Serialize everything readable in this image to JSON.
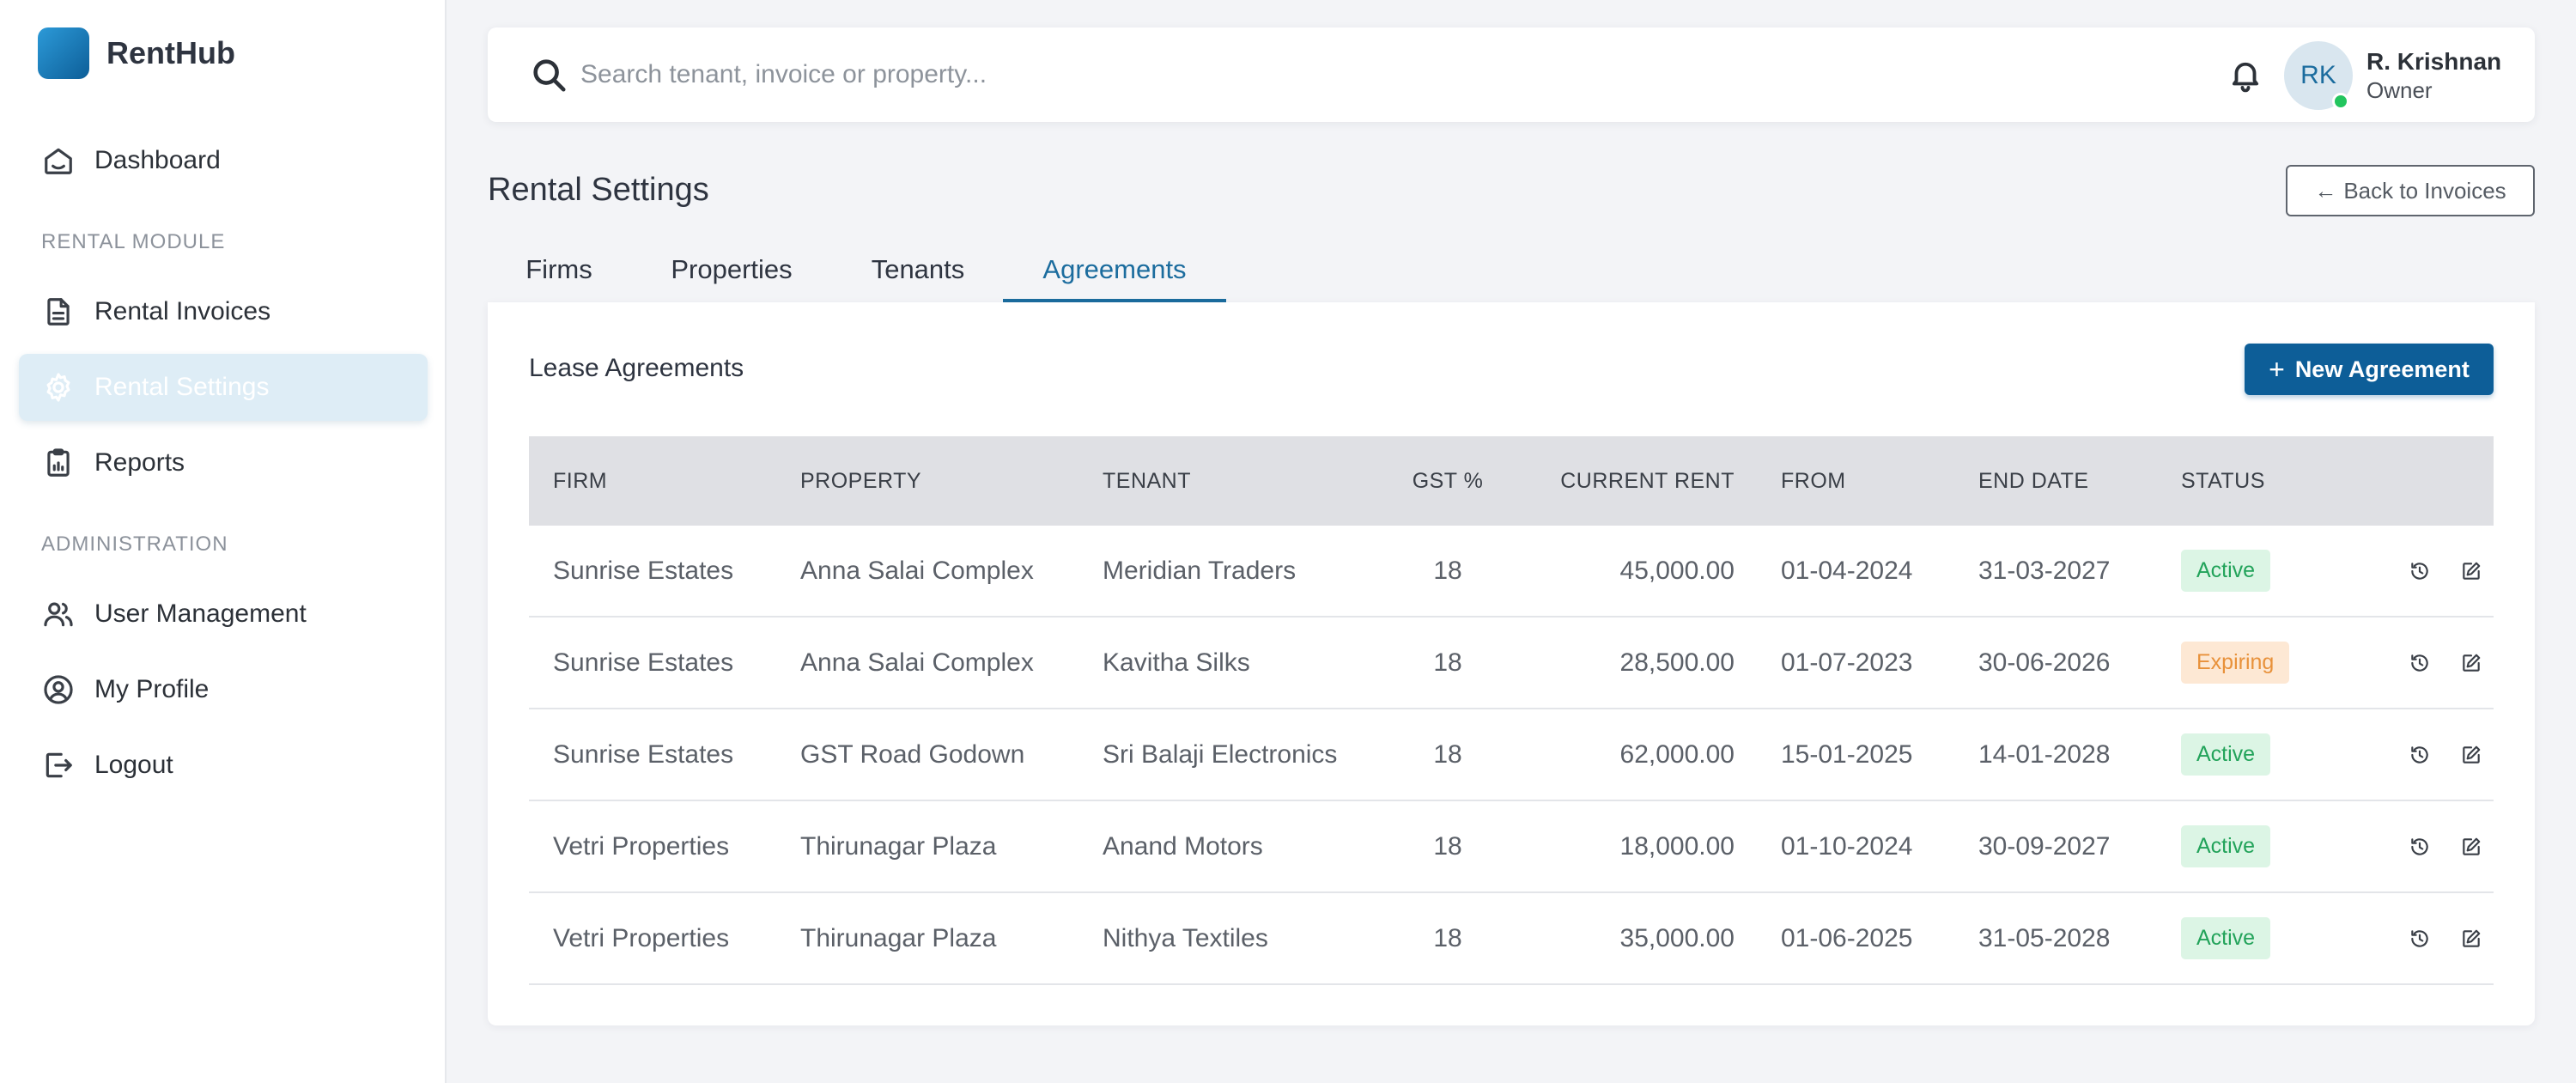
{
  "app": {
    "name": "RentHub"
  },
  "sidebar": {
    "items": [
      {
        "label": "Dashboard",
        "icon": "home-icon"
      },
      {
        "label": "Rental Invoices",
        "icon": "document-icon"
      },
      {
        "label": "Rental Settings",
        "icon": "gear-icon",
        "active": true
      },
      {
        "label": "Reports",
        "icon": "clipboard-icon"
      },
      {
        "label": "User Management",
        "icon": "users-icon"
      },
      {
        "label": "My Profile",
        "icon": "user-circle-icon"
      },
      {
        "label": "Logout",
        "icon": "logout-icon"
      }
    ],
    "sections": {
      "rental": "RENTAL MODULE",
      "admin": "ADMINISTRATION"
    }
  },
  "search": {
    "placeholder": "Search tenant, invoice or property...",
    "value": ""
  },
  "user": {
    "initials": "RK",
    "name": "R. Krishnan",
    "role": "Owner",
    "online": true
  },
  "page": {
    "title": "Rental Settings",
    "back_label": "Back to Invoices"
  },
  "tabs": [
    {
      "label": "Firms"
    },
    {
      "label": "Properties"
    },
    {
      "label": "Tenants"
    },
    {
      "label": "Agreements",
      "active": true
    }
  ],
  "card": {
    "title": "Lease Agreements",
    "new_label": "New Agreement"
  },
  "table": {
    "headers": [
      "FIRM",
      "PROPERTY",
      "TENANT",
      "GST %",
      "CURRENT RENT",
      "FROM",
      "END DATE",
      "STATUS"
    ],
    "rows": [
      {
        "firm": "Sunrise Estates",
        "property": "Anna Salai Complex",
        "tenant": "Meridian Traders",
        "gst": "18",
        "rent": "45,000.00",
        "from": "01-04-2024",
        "end": "31-03-2027",
        "status": "Active"
      },
      {
        "firm": "Sunrise Estates",
        "property": "Anna Salai Complex",
        "tenant": "Kavitha Silks",
        "gst": "18",
        "rent": "28,500.00",
        "from": "01-07-2023",
        "end": "30-06-2026",
        "status": "Expiring"
      },
      {
        "firm": "Sunrise Estates",
        "property": "GST Road Godown",
        "tenant": "Sri Balaji Electronics",
        "gst": "18",
        "rent": "62,000.00",
        "from": "15-01-2025",
        "end": "14-01-2028",
        "status": "Active"
      },
      {
        "firm": "Vetri Properties",
        "property": "Thirunagar Plaza",
        "tenant": "Anand Motors",
        "gst": "18",
        "rent": "18,000.00",
        "from": "01-10-2024",
        "end": "30-09-2027",
        "status": "Active"
      },
      {
        "firm": "Vetri Properties",
        "property": "Thirunagar Plaza",
        "tenant": "Nithya Textiles",
        "gst": "18",
        "rent": "35,000.00",
        "from": "01-06-2025",
        "end": "31-05-2028",
        "status": "Active"
      }
    ]
  },
  "colors": {
    "primary": "#0d5e98",
    "accent": "#1b6c9e",
    "active_nav_bg": "#deedf6",
    "status_active_bg": "#dcf5e5",
    "status_active_text": "#22a35a",
    "status_expiring_bg": "#fde8d4",
    "status_expiring_text": "#e8913a",
    "online": "#22c55e"
  }
}
